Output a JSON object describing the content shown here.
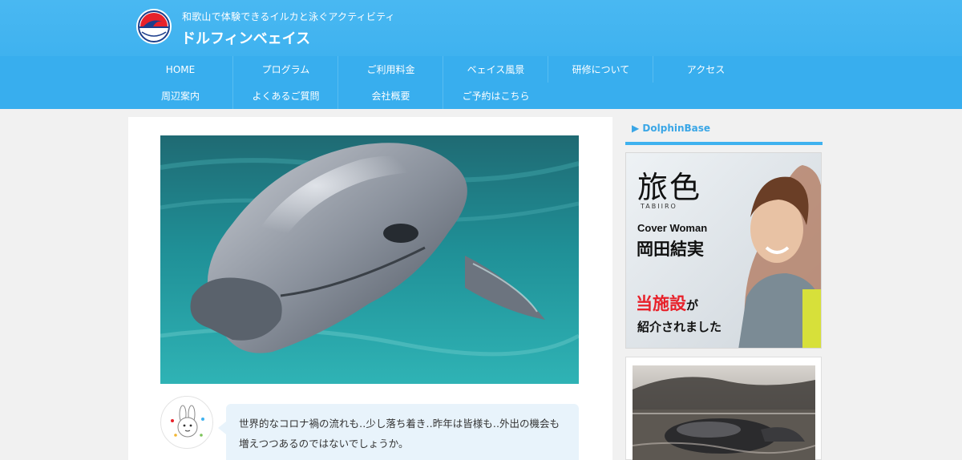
{
  "header": {
    "tagline": "和歌山で体験できるイルカと泳ぐアクティビティ",
    "site_title": "ドルフィンベェイス"
  },
  "nav": {
    "items": [
      {
        "label": "HOME"
      },
      {
        "label": "プログラム"
      },
      {
        "label": "ご利用料金"
      },
      {
        "label": "ベェイス風景"
      },
      {
        "label": "研修について"
      },
      {
        "label": "アクセス"
      },
      {
        "label": "周辺案内"
      },
      {
        "label": "よくあるご質問"
      },
      {
        "label": "会社概要"
      },
      {
        "label": "ご予約はこちら"
      }
    ]
  },
  "main": {
    "bubble_text": "世界的なコロナ禍の流れも‥少し落ち着き‥昨年は皆様も‥外出の機会も増えつつあるのではないでしょうか。"
  },
  "sidebar": {
    "widget_title": "▶ DolphinBase",
    "ad": {
      "logo_big": "旅色",
      "logo_small": "TABIIRO",
      "cover_label": "Cover Woman",
      "name": "岡田結実",
      "headline_red": "当施設",
      "headline_particle": "が",
      "headline_rest": "紹介されました"
    }
  },
  "colors": {
    "header_blue": "#49b8f2",
    "nav_blue": "#38aeee",
    "accent_red": "#e8212a"
  }
}
